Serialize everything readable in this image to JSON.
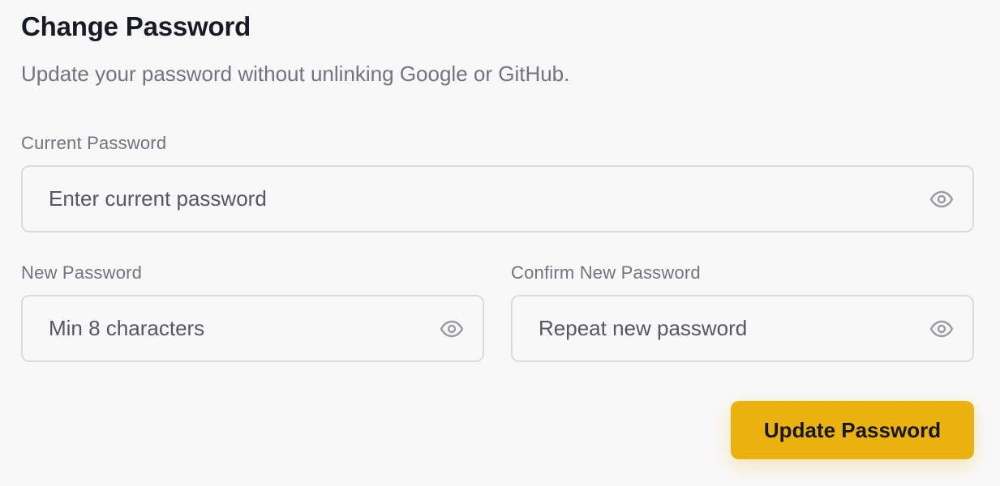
{
  "header": {
    "title": "Change Password",
    "subtitle": "Update your password without unlinking Google or GitHub."
  },
  "fields": {
    "current": {
      "label": "Current Password",
      "placeholder": "Enter current password",
      "value": "",
      "icon": "eye-icon"
    },
    "new": {
      "label": "New Password",
      "placeholder": "Min 8 characters",
      "value": "",
      "icon": "eye-icon"
    },
    "confirm": {
      "label": "Confirm New Password",
      "placeholder": "Repeat new password",
      "value": "",
      "icon": "eye-icon"
    }
  },
  "actions": {
    "submit_label": "Update Password"
  },
  "colors": {
    "background": "#f8f8f8",
    "accent": "#ebb20d",
    "title": "#161b26",
    "muted_text": "#6f7480",
    "border": "#dcdcdc"
  }
}
